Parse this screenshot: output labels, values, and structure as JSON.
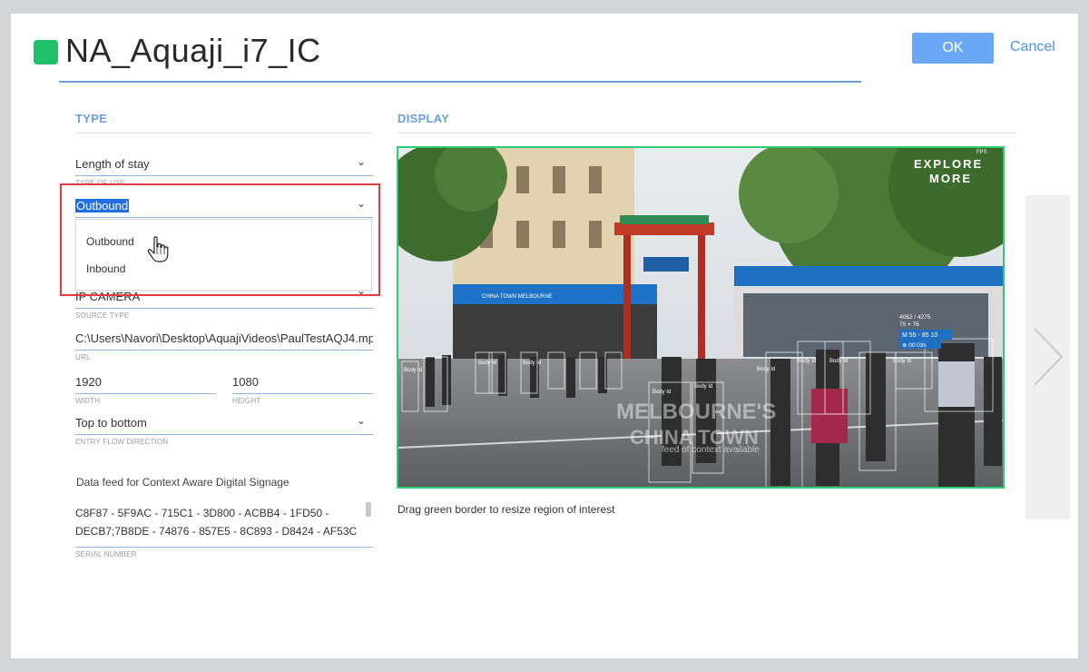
{
  "header": {
    "title": "NA_Aquaji_i7_IC",
    "status_color": "#1fbf6b",
    "ok_label": "OK",
    "cancel_label": "Cancel"
  },
  "type_section": {
    "heading": "TYPE",
    "type_of_use": {
      "value": "Length of stay",
      "caption": "TYPE OF USE"
    },
    "direction_select": {
      "value": "Outbound",
      "options": [
        "Outbound",
        "Inbound"
      ]
    },
    "source_type": {
      "value": "IP CAMERA",
      "caption": "SOURCE TYPE"
    },
    "url": {
      "value": "C:\\Users\\Navori\\Desktop\\AquajiVideos\\PaulTestAQJ4.mp",
      "caption": "URL"
    },
    "width": {
      "value": "1920",
      "caption": "WIDTH"
    },
    "height": {
      "value": "1080",
      "caption": "HEIGHT"
    },
    "entry_flow": {
      "value": "Top to bottom",
      "caption": "ENTRY FLOW DIRECTION"
    },
    "data_feed_label": "Data feed for Context Aware Digital Signage",
    "serial_number": {
      "line1": "C8F87 - 5F9AC - 715C1 - 3D800 - ACBB4 - 1FD50 -",
      "line2": "DECB7;7B8DE - 74876 - 857E5 - 8C893 - D8424 - AF53C",
      "caption": "SERIAL NUMBER"
    }
  },
  "display_section": {
    "heading": "DISPLAY",
    "hint": "Drag green border to resize region of interest",
    "overlay": {
      "explore": "EXPLORE",
      "more": "MORE",
      "watermark1": "MELBOURNE'S",
      "watermark2": "CHINA TOWN",
      "caption": "feed of context available",
      "store_sign": "CHINA TOWN MELBOURNE",
      "counter1": "4062 / 4275",
      "counter2": "75 ⌖ 76",
      "m_badge": "M 55 - 85 10",
      "time_badge": "⊕ 00:03s",
      "fps": "FPS",
      "body_label": "Body Id"
    },
    "border_color": "#2ecc71"
  },
  "icons": {
    "cursor": "hand-pointer-icon",
    "dropdown": "chevron-down-icon",
    "next": "chevron-right-icon"
  }
}
